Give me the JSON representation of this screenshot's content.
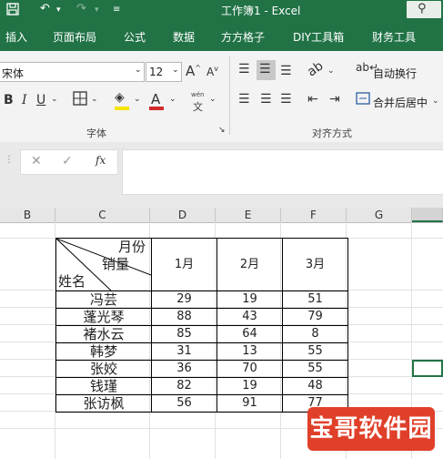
{
  "window": {
    "title": "工作簿1  -  Excel"
  },
  "menu": [
    "插入",
    "页面布局",
    "公式",
    "数据",
    "方方格子",
    "DIY工具箱",
    "财务工具"
  ],
  "ribbon": {
    "font_name": "宋体",
    "font_size": "12",
    "grow_font": "A",
    "shrink_font": "A",
    "bold": "B",
    "italic": "I",
    "underline": "U",
    "wen_top": "wén",
    "wen_bottom": "文",
    "font_group": "字体",
    "align_group": "对齐方式",
    "wrap_text": "自动换行",
    "merge_center": "合并后居中"
  },
  "formula_bar": {
    "cancel": "✕",
    "enter": "✓",
    "fx": "fx",
    "value": ""
  },
  "sheet": {
    "columns": [
      "B",
      "C",
      "D",
      "E",
      "F",
      "G"
    ],
    "diag_header": {
      "top_right": "月份",
      "middle": "销量",
      "bottom_left": "姓名"
    },
    "months": [
      "1月",
      "2月",
      "3月"
    ],
    "rows": [
      {
        "name": "冯芸",
        "values": [
          "29",
          "19",
          "51"
        ]
      },
      {
        "name": "蓬光琴",
        "values": [
          "88",
          "43",
          "79"
        ]
      },
      {
        "name": "褚水云",
        "values": [
          "85",
          "64",
          "8"
        ]
      },
      {
        "name": "韩梦",
        "values": [
          "31",
          "13",
          "55"
        ]
      },
      {
        "name": "张姣",
        "values": [
          "36",
          "70",
          "55"
        ]
      },
      {
        "name": "钱瑾",
        "values": [
          "82",
          "19",
          "48"
        ]
      },
      {
        "name": "张访枫",
        "values": [
          "56",
          "91",
          "77"
        ]
      }
    ]
  },
  "watermark": "宝哥软件园"
}
